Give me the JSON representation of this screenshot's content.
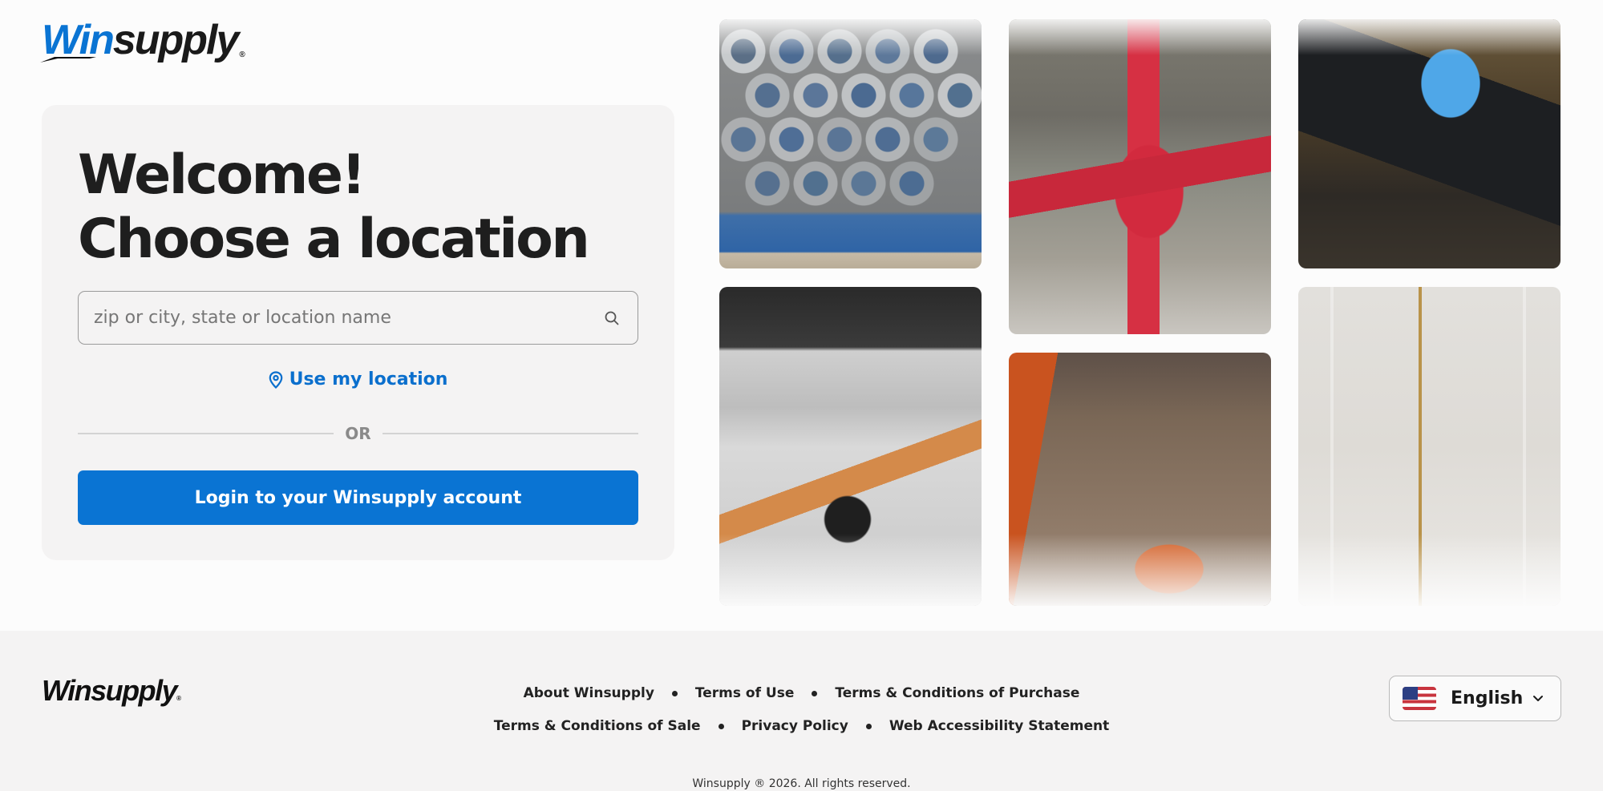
{
  "brand": {
    "logo_prefix": "Win",
    "logo_suffix": "supply",
    "registered": "®",
    "accent_color": "#0a74d3",
    "text_color": "#1e1e1e"
  },
  "welcome": {
    "title_line1": "Welcome!",
    "title_line2": "Choose a location"
  },
  "search": {
    "placeholder": "zip or city, state or location name",
    "value": "",
    "icon": "search-icon"
  },
  "use_location": {
    "label": "Use my location",
    "icon": "map-pin-icon"
  },
  "divider": {
    "label": "OR"
  },
  "login_button": {
    "label": "Login to your Winsupply account"
  },
  "gallery": {
    "images": [
      "stacked-galvanized-pipes",
      "red-fire-sprinkler-pipe",
      "digital-multimeter",
      "water-heater-wrench",
      "orange-sewer-pipe-trench",
      "glass-shower-enclosure"
    ]
  },
  "footer": {
    "logo_prefix": "Win",
    "logo_suffix": "supply",
    "registered": "®",
    "links_row1": [
      "About Winsupply",
      "Terms of Use",
      "Terms & Conditions of Purchase"
    ],
    "links_row2": [
      "Terms & Conditions of Sale",
      "Privacy Policy",
      "Web Accessibility Statement"
    ],
    "language": {
      "selected": "English",
      "flag": "us-flag-icon",
      "icon": "chevron-down-icon"
    },
    "copyright": "Winsupply ® 2026. All rights reserved."
  }
}
